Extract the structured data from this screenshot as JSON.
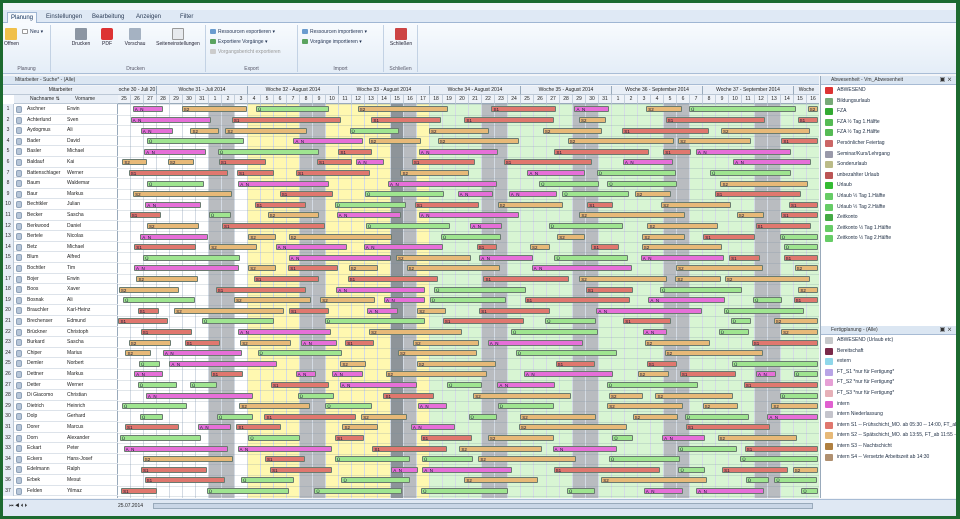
{
  "tabs": [
    "Planung",
    "Einstellungen",
    "Bearbeitung",
    "Anzeigen",
    "Filter"
  ],
  "ribbon": {
    "groups": [
      {
        "label": "Planung",
        "buttons": [
          "Neu",
          "Offnen"
        ]
      },
      {
        "label": "Drucken",
        "buttons": [
          "Drucken",
          "PDF",
          "Vorschau",
          "Seiteneinstellungen"
        ]
      },
      {
        "label": "Export",
        "items": [
          "Ressourcen exportieren",
          "Exportiere Vorgänge",
          "Vorgangsbericht exportieren"
        ]
      },
      {
        "label": "Import",
        "items": [
          "Ressourcen importieren",
          "Vorgänge importieren"
        ]
      },
      {
        "label": "Schließen",
        "buttons": [
          "Schließen"
        ]
      }
    ]
  },
  "main": {
    "title": "Mitarbeiter - Suche* - (Alle)",
    "col_group": "Mitarbeiter",
    "col_last": "Nachname",
    "col_first": "Vorname"
  },
  "weeks": [
    "oche 30 - Juli 20",
    "Woche 31 - Juli 2014",
    "Woche 32 - August 2014",
    "Woche 33 - August 2014",
    "Woche 34 - August 2014",
    "Woche 35 - August 2014",
    "Woche 36 - September 2014",
    "Woche 37 - September 2014",
    "Woche"
  ],
  "days": [
    "25",
    "26",
    "27",
    "28",
    "29",
    "30",
    "31",
    "1",
    "2",
    "3",
    "4",
    "5",
    "6",
    "7",
    "8",
    "9",
    "10",
    "11",
    "12",
    "13",
    "14",
    "15",
    "16",
    "17",
    "18",
    "19",
    "20",
    "21",
    "22",
    "23",
    "24",
    "25",
    "26",
    "27",
    "28",
    "29",
    "30",
    "31",
    "1",
    "2",
    "3",
    "4",
    "5",
    "6",
    "7",
    "8",
    "9",
    "10",
    "11",
    "12",
    "13",
    "14",
    "15",
    "16"
  ],
  "employees": [
    [
      "Aschner",
      "Erwin"
    ],
    [
      "Achterlund",
      "Sven"
    ],
    [
      "Aydogmus",
      "Ali"
    ],
    [
      "Bader",
      "David"
    ],
    [
      "Basler",
      "Michael"
    ],
    [
      "Baldauf",
      "Kai"
    ],
    [
      "Battenschlager",
      "Werner"
    ],
    [
      "Baum",
      "Waldemar"
    ],
    [
      "Baur",
      "Markus"
    ],
    [
      "Bechtkler",
      "Julian"
    ],
    [
      "Becker",
      "Sascha"
    ],
    [
      "Berkwood",
      "Daniel"
    ],
    [
      "Bertele",
      "Nicolas"
    ],
    [
      "Betz",
      "Michael"
    ],
    [
      "Blum",
      "Alfred"
    ],
    [
      "Bochtler",
      "Tim"
    ],
    [
      "Bojer",
      "Erwin"
    ],
    [
      "Boos",
      "Xaver"
    ],
    [
      "Bosnak",
      "Ali"
    ],
    [
      "Brauchler",
      "Karl-Heinz"
    ],
    [
      "Brechenser",
      "Edmund"
    ],
    [
      "Brückner",
      "Christoph"
    ],
    [
      "Burkard",
      "Sascha"
    ],
    [
      "Chiper",
      "Marius"
    ],
    [
      "Demler",
      "Norbert"
    ],
    [
      "Dettner",
      "Markus"
    ],
    [
      "Detter",
      "Werner"
    ],
    [
      "Di Giacomo",
      "Christian"
    ],
    [
      "Dietrich",
      "Heinrich"
    ],
    [
      "Dolp",
      "Gerhard"
    ],
    [
      "Dorer",
      "Marcus"
    ],
    [
      "Dorn",
      "Alexander"
    ],
    [
      "Eckart",
      "Peter"
    ],
    [
      "Eckers",
      "Hans-Josef"
    ],
    [
      "Edelmann",
      "Ralph"
    ],
    [
      "Erbek",
      "Mesut"
    ],
    [
      "Felden",
      "Yilmaz"
    ]
  ],
  "bar_labels": [
    "ZK",
    "S1",
    "S2",
    "A_N",
    "Fr",
    "Ü",
    "Überstunden, 2h/Feiertagzeitplan",
    "Urlaub"
  ],
  "absence_panel": {
    "title": "Abwesenheit - Vm_Abwesenheit",
    "items": [
      "ABWESEND",
      "Bildungsurlaub",
      "FZA",
      "FZA ½ Tag 1.Hälfte",
      "FZA ½ Tag 2.Hälfte",
      "Persönlicher Feiertag",
      "Seminar/Kurs/Lehrgang",
      "Sonderurlaub",
      "unbezahlter Urlaub",
      "Urlaub",
      "Urlaub ½ Tag 1.Hälfte",
      "Urlaub ½ Tag 2.Hälfte",
      "Zeitkonto",
      "Zeitkonto ½ Tag 1.Hälfte",
      "Zeitkonto ½ Tag 2.Hälfte"
    ]
  },
  "shift_panel": {
    "title": "Fertigplanung - (Alle)",
    "items": [
      "ABWESEND (Urlaub etc)",
      "Bereitschaft",
      "extern",
      "FT_S1 *nur für Fertigung*",
      "FT_S2 *nur für Fertigung*",
      "FT_S3 *nur für Fertigung*",
      "intern",
      "intern Niederlassung",
      "intern S1 -- Frühschicht_MO. ab 05:30 -- 14:00, FT_ab 06:00 -- 12:00",
      "intern S2 -- Spätschicht_MO. ab 13:55, FT_ab 11:55 -- 18:00",
      "intern S3 -- Nachtschicht",
      "intern S4 -- Versetzte Arbeitszeit ab 14:30"
    ]
  },
  "status": {
    "date": "25.07.2014"
  },
  "colors": {
    "weekend": "#b9bcc0",
    "today": "#8e9499",
    "yellow": "#fff8b0",
    "lightgreen": "#d8f5d3",
    "s1": "#e0776e",
    "s2": "#e7b978",
    "pink": "#e66fd8",
    "green": "#9fe590",
    "ribbon": "#dfe9f5"
  }
}
